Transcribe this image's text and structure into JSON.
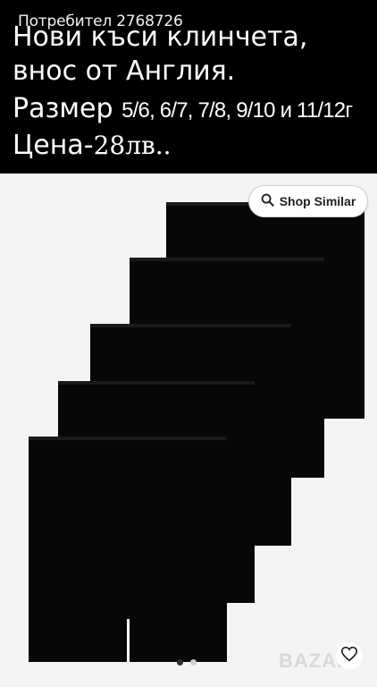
{
  "header": {
    "user_label": "Потребител 2768726",
    "title_line1": "Нови къси клинчета,",
    "title_line2": "внос от Англия.",
    "size_label": "Размер",
    "sizes": "5/6, 6/7, 7/8, 9/10 и 11/12г",
    "price_label": "Цена-",
    "price_value": "28лв.."
  },
  "photo": {
    "shop_similar_label": "Shop Similar",
    "item_color": "#070707",
    "carousel": {
      "total": 2,
      "active": 1
    }
  },
  "watermark": {
    "brand": "BAZAR"
  },
  "icons": [
    "search-icon",
    "heart-icon"
  ]
}
